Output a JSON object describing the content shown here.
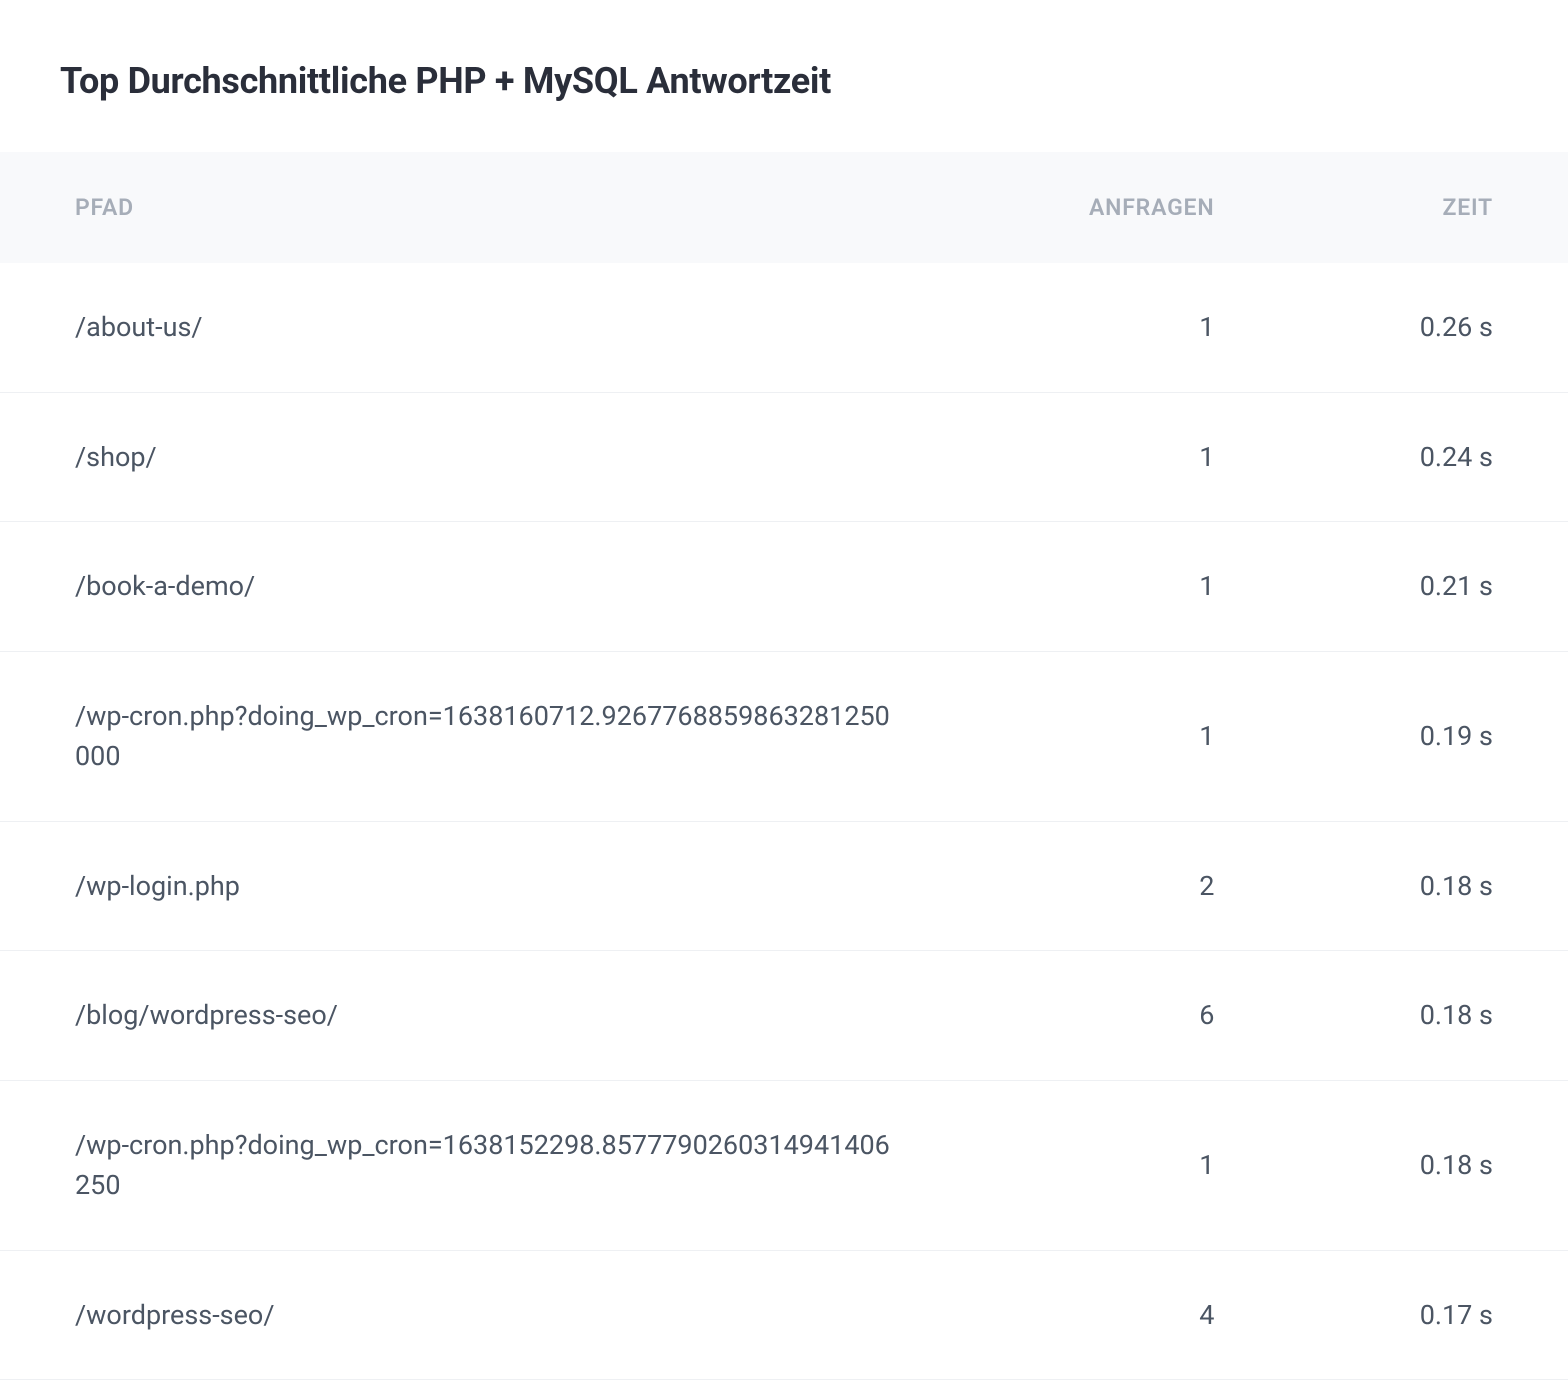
{
  "title": "Top Durchschnittliche PHP + MySQL Antwortzeit",
  "columns": {
    "path": "PFAD",
    "requests": "ANFRAGEN",
    "time": "ZEIT"
  },
  "rows": [
    {
      "path": "/about-us/",
      "requests": "1",
      "time": "0.26 s"
    },
    {
      "path": "/shop/",
      "requests": "1",
      "time": "0.24 s"
    },
    {
      "path": "/book-a-demo/",
      "requests": "1",
      "time": "0.21 s"
    },
    {
      "path": "/wp-cron.php?doing_wp_cron=1638160712.9267768859863281250000",
      "requests": "1",
      "time": "0.19 s"
    },
    {
      "path": "/wp-login.php",
      "requests": "2",
      "time": "0.18 s"
    },
    {
      "path": "/blog/wordpress-seo/",
      "requests": "6",
      "time": "0.18 s"
    },
    {
      "path": "/wp-cron.php?doing_wp_cron=1638152298.8577790260314941406250",
      "requests": "1",
      "time": "0.18 s"
    },
    {
      "path": "/wordpress-seo/",
      "requests": "4",
      "time": "0.17 s"
    }
  ]
}
